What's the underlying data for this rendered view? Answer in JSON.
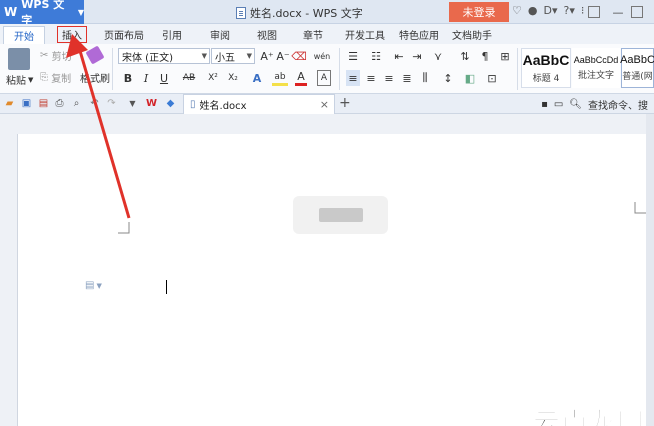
{
  "window": {
    "app_name": "WPS 文字",
    "logo": "W",
    "doc_title": "姓名.docx - WPS 文字",
    "login_label": "未登录",
    "title_icons": [
      "skin-icon",
      "info-icon",
      "pdf-icon",
      "help-icon",
      "menu-icon"
    ],
    "controls": [
      "□",
      "—",
      "⊠"
    ]
  },
  "tabs": [
    {
      "label": "开始"
    },
    {
      "label": "插入"
    },
    {
      "label": "页面布局"
    },
    {
      "label": "引用"
    },
    {
      "label": "审阅"
    },
    {
      "label": "视图"
    },
    {
      "label": "章节"
    },
    {
      "label": "开发工具"
    },
    {
      "label": "特色应用"
    },
    {
      "label": "文档助手"
    }
  ],
  "ribbon": {
    "paste": "粘贴",
    "cut": "剪切",
    "copy": "复制",
    "format_painter": "格式刷",
    "font_name": "宋体 (正文)",
    "font_size": "小五",
    "grow_font": "A⁺",
    "shrink_font": "A⁻",
    "clear_format": "⌫",
    "phonetic": "wén",
    "bold": "B",
    "italic": "I",
    "underline": "U",
    "strikethrough": "AB",
    "superscript": "X²",
    "subscript": "X₂",
    "text_effect": "A",
    "highlight": "ab",
    "font_color": "A",
    "font_border": "A",
    "styles": [
      {
        "preview": "AaBbC",
        "caption": "标题 4"
      },
      {
        "preview": "AaBbCcDd",
        "caption": "批注文字"
      },
      {
        "preview": "AaBbC",
        "caption": "普通(网"
      }
    ]
  },
  "quickbar": {
    "doc_tab_label": "姓名.docx",
    "close": "×",
    "add": "+",
    "search_label": "查找命令、搜"
  },
  "document": {
    "site_watermark": "云南龙网"
  },
  "colors": {
    "app_blue": "#3e7bd8",
    "login_orange": "#e9694c",
    "arrow_red": "#e0322a"
  }
}
